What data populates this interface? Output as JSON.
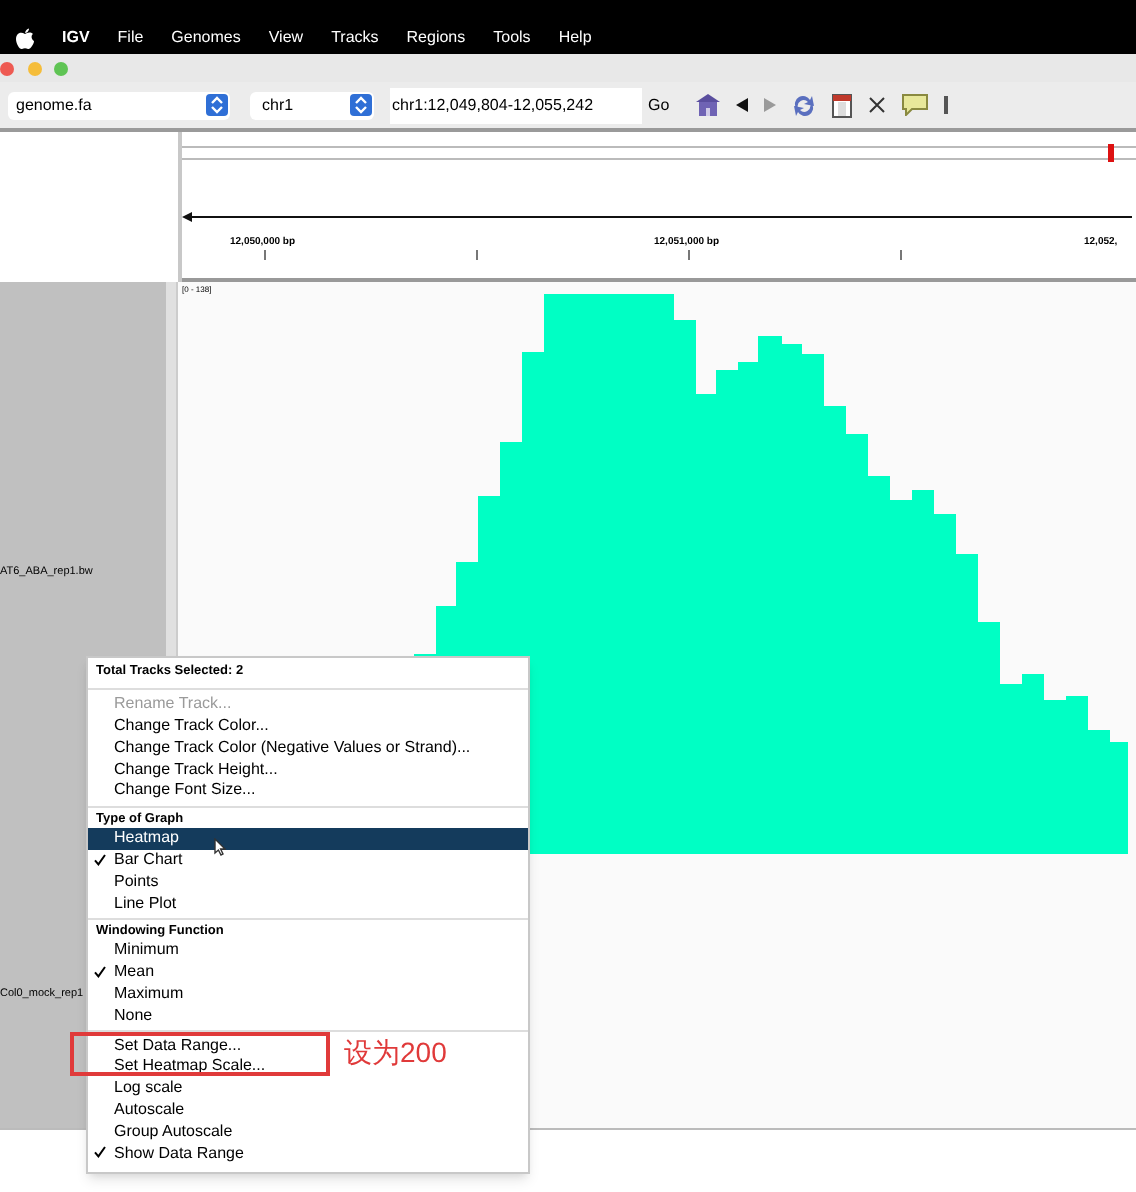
{
  "menubar": {
    "app": "IGV",
    "items": [
      "File",
      "Genomes",
      "View",
      "Tracks",
      "Regions",
      "Tools",
      "Help"
    ]
  },
  "toolbar": {
    "genome": "genome.fa",
    "chromosome": "chr1",
    "locus": "chr1:12,049,804-12,055,242",
    "go_button": "Go",
    "forward_disabled": true
  },
  "ruler": {
    "ticks": [
      "12,050,000 bp",
      "12,051,000 bp",
      "12,052,"
    ]
  },
  "tracks": [
    {
      "name": "AT6_ABA_rep1.bw",
      "data_range": "[0 - 138]"
    },
    {
      "name": "Col0_mock_rep1"
    }
  ],
  "context_menu": {
    "title": "Total Tracks Selected: 2",
    "sections": [
      {
        "items": [
          {
            "label": "Rename Track...",
            "disabled": true,
            "checked": false,
            "selected": false
          },
          {
            "label": "Change Track Color...",
            "disabled": false,
            "checked": false,
            "selected": false
          },
          {
            "label": "Change Track Color (Negative Values or Strand)...",
            "disabled": false,
            "checked": false,
            "selected": false
          },
          {
            "label": "Change Track Height...",
            "disabled": false,
            "checked": false,
            "selected": false
          },
          {
            "label": "Change Font Size...",
            "disabled": false,
            "checked": false,
            "selected": false
          }
        ]
      },
      {
        "heading": "Type of Graph",
        "items": [
          {
            "label": "Heatmap",
            "disabled": false,
            "checked": false,
            "selected": true
          },
          {
            "label": "Bar Chart",
            "disabled": false,
            "checked": true,
            "selected": false
          },
          {
            "label": "Points",
            "disabled": false,
            "checked": false,
            "selected": false
          },
          {
            "label": "Line Plot",
            "disabled": false,
            "checked": false,
            "selected": false
          }
        ]
      },
      {
        "heading": "Windowing Function",
        "items": [
          {
            "label": "Minimum",
            "disabled": false,
            "checked": false,
            "selected": false
          },
          {
            "label": "Mean",
            "disabled": false,
            "checked": true,
            "selected": false
          },
          {
            "label": "Maximum",
            "disabled": false,
            "checked": false,
            "selected": false
          },
          {
            "label": "None",
            "disabled": false,
            "checked": false,
            "selected": false
          }
        ]
      },
      {
        "items": [
          {
            "label": "Set Data Range...",
            "disabled": false,
            "checked": false,
            "selected": false
          },
          {
            "label": "Set Heatmap Scale...",
            "disabled": false,
            "checked": false,
            "selected": false
          },
          {
            "label": "Log scale",
            "disabled": false,
            "checked": false,
            "selected": false
          },
          {
            "label": "Autoscale",
            "disabled": false,
            "checked": false,
            "selected": false
          },
          {
            "label": "Group Autoscale",
            "disabled": false,
            "checked": false,
            "selected": false
          },
          {
            "label": "Show Data Range",
            "disabled": false,
            "checked": true,
            "selected": false
          }
        ]
      }
    ]
  },
  "annotation": {
    "text": "设为200"
  }
}
